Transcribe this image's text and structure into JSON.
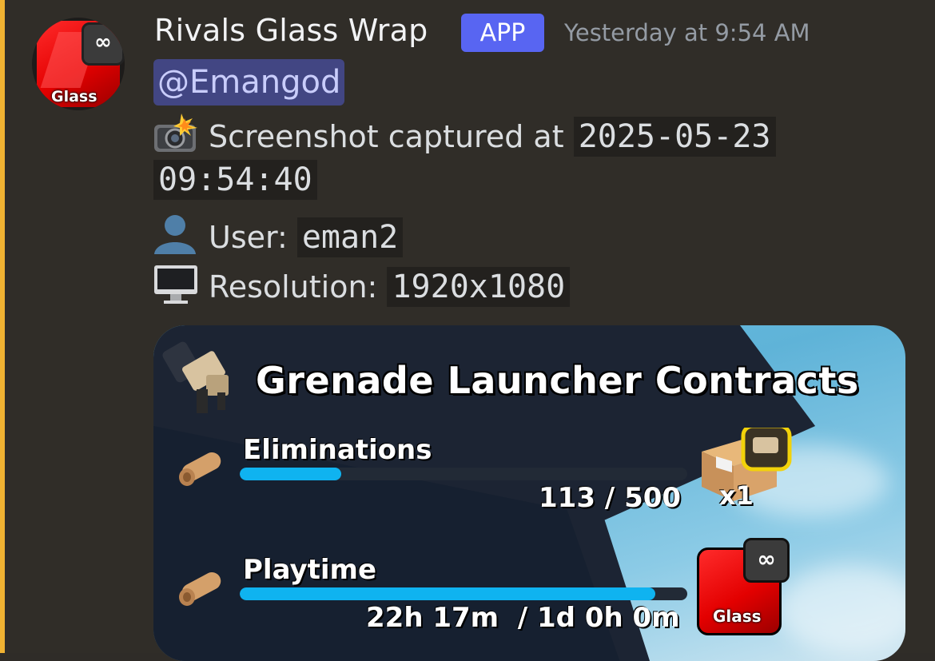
{
  "message": {
    "author": "Rivals Glass Wrap",
    "badge": "APP",
    "timestamp": "Yesterday at 9:54 AM",
    "mention": "@Emangod",
    "lines": {
      "capture_prefix": "Screenshot captured at",
      "capture_date": "2025-05-23",
      "capture_time": "09:54:40",
      "user_prefix": "User:",
      "user_value": "eman2",
      "resolution_prefix": "Resolution:",
      "resolution_value": "1920x1080"
    },
    "avatar_label": "Glass",
    "avatar_badge": "∞"
  },
  "embed": {
    "title": "Grenade Launcher Contracts",
    "contracts": [
      {
        "label": "Eliminations",
        "current": 113,
        "goal": 500,
        "progress_text": "113 / 500",
        "progress": 0.226,
        "reward_count": "x1"
      },
      {
        "label": "Playtime",
        "progress_text": "22h 17m  / 1d 0h 0m",
        "progress": 0.928,
        "reward_label": "Glass",
        "reward_badge": "∞"
      }
    ]
  },
  "colors": {
    "mention_bar": "#f0b232",
    "app_badge": "#5865f2",
    "progress_fill": "#0fb3f0"
  },
  "icons": {
    "capture": "camera-flash-icon",
    "user": "user-silhouette-icon",
    "resolution": "desktop-monitor-icon",
    "contract": "scroll-icon"
  }
}
